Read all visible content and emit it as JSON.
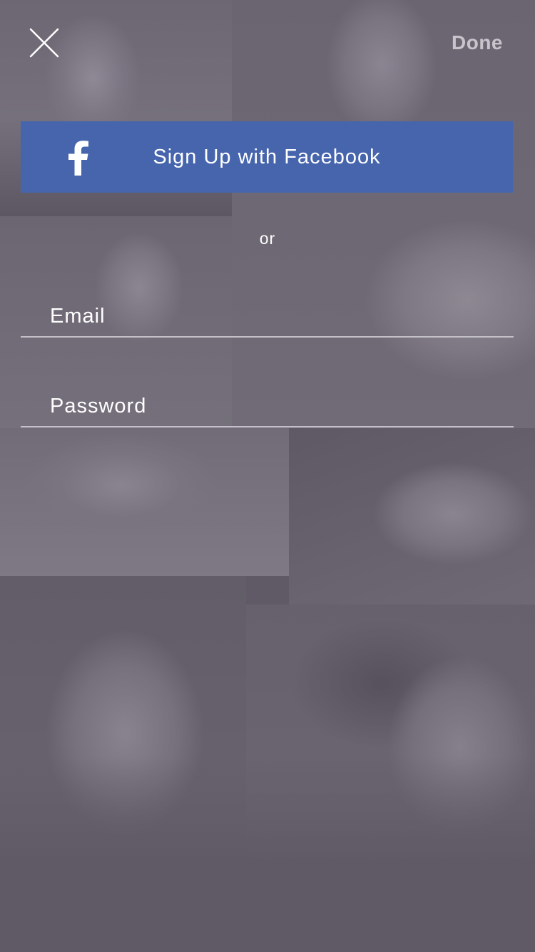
{
  "header": {
    "close_icon": "close-icon",
    "done_label": "Done"
  },
  "facebook": {
    "icon": "facebook-icon",
    "label": "Sign Up with Facebook",
    "color": "#4665ad"
  },
  "separator": {
    "label": "or"
  },
  "form": {
    "email_placeholder": "Email",
    "password_placeholder": "Password"
  },
  "colors": {
    "background": "#5f5a66",
    "accent": "#4665ad",
    "text": "#ffffff",
    "done_text": "#c8c4cc"
  }
}
